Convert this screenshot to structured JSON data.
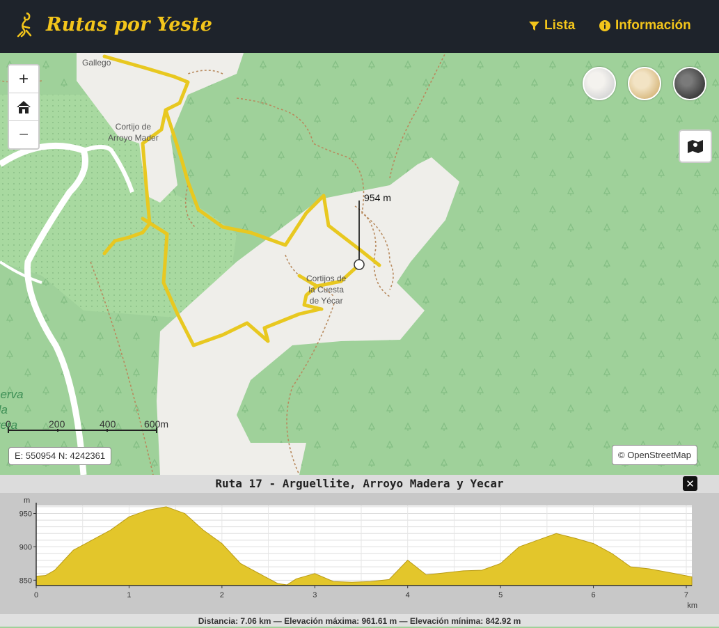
{
  "header": {
    "brand": "Rutas por Yeste",
    "nav": {
      "lista": "Lista",
      "info": "Información"
    },
    "icons": {
      "logo": "hiker-logo-icon",
      "lista": "filter-icon",
      "info": "info-circle-icon"
    }
  },
  "map": {
    "zoom": {
      "in": "+",
      "out": "−"
    },
    "places": {
      "gallego": "Gallego",
      "arroyo_madera": "Cortijo de\nArroyo Mader",
      "yecar": "Cortijos de\nla Cuesta\nde Yécar"
    },
    "reserve_label": "serva\nda\nvera",
    "elevation_marker": "954 m",
    "scale": [
      "0",
      "200",
      "400",
      "600m"
    ],
    "coords": "E: 550954 N: 4242361",
    "attribution": "© OpenStreetMap",
    "layers": [
      "street-map-layer",
      "topo-map-layer",
      "satellite-map-layer"
    ]
  },
  "profile": {
    "title": "Ruta 17 - Arguellite, Arroyo Madera y Yecar",
    "y_unit": "m",
    "x_unit": "km",
    "footer": "Distancia: 7.06 km — Elevación máxima: 961.61 m — Elevación mínima: 842.92 m"
  },
  "chart_data": {
    "type": "area",
    "title": "Ruta 17 - Arguellite, Arroyo Madera y Yecar",
    "xlabel": "km",
    "ylabel": "m",
    "xlim": [
      0,
      7.06
    ],
    "ylim": [
      842,
      962
    ],
    "x_ticks": [
      "0",
      "1",
      "2",
      "3",
      "4",
      "5",
      "6",
      "7"
    ],
    "y_ticks": [
      "850",
      "900",
      "950"
    ],
    "series": [
      {
        "x": [
          0,
          0.1,
          0.2,
          0.4,
          0.6,
          0.8,
          1.0,
          1.2,
          1.4,
          1.6,
          1.8,
          2.0,
          2.2,
          2.4,
          2.6,
          2.7,
          2.8,
          3.0,
          3.2,
          3.4,
          3.6,
          3.8,
          4.0,
          4.2,
          4.4,
          4.6,
          4.8,
          5.0,
          5.2,
          5.4,
          5.6,
          5.8,
          6.0,
          6.2,
          6.4,
          6.6,
          6.8,
          7.06
        ],
        "y": [
          856,
          857,
          865,
          895,
          910,
          925,
          945,
          955,
          960,
          950,
          925,
          905,
          875,
          860,
          845,
          843,
          852,
          860,
          848,
          847,
          848,
          851,
          880,
          858,
          861,
          864,
          865,
          875,
          900,
          910,
          920,
          913,
          905,
          890,
          870,
          867,
          862,
          855
        ]
      }
    ],
    "grid": true
  }
}
